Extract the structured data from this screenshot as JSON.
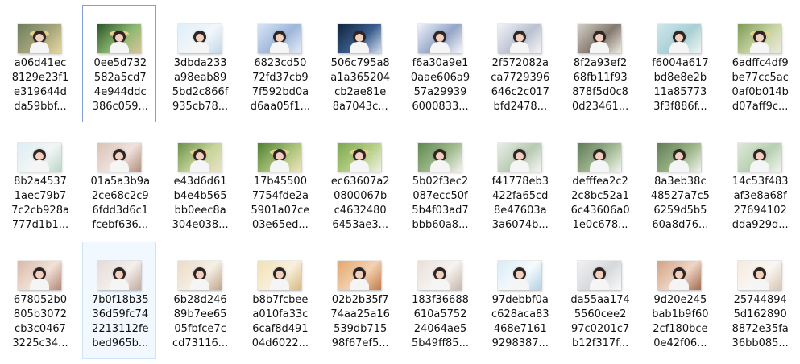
{
  "files": [
    {
      "name": "a06d41ec\n8129e23f1\ne319644d\nda59bbf...",
      "colors": [
        "#6c7e5e",
        "#a8a77c",
        "#e9d8a3"
      ]
    },
    {
      "name": "0ee5d732\n582a5cd7\n4e944ddc\n386c059...",
      "colors": [
        "#2c5728",
        "#8fb873",
        "#d7c69a"
      ]
    },
    {
      "name": "3dbda233\na98eab89\n5bd2c866f\n935cb78...",
      "colors": [
        "#dfeef9",
        "#f2f7fb",
        "#c4d7e7"
      ]
    },
    {
      "name": "6823cd50\n72fd37cb9\n7f592bd0a\nd6aa05f1...",
      "colors": [
        "#d8e5f6",
        "#9eb6da",
        "#e8edf5"
      ]
    },
    {
      "name": "506c795a8\na1a365204\ncb2ae81e\n8a7043c...",
      "colors": [
        "#10243f",
        "#3a5e8d",
        "#d8e0f0"
      ]
    },
    {
      "name": "f6a30a9e1\n0aae606a9\n57a29939\n6000833...",
      "colors": [
        "#eef2fb",
        "#94a5c7",
        "#f6f7fb"
      ]
    },
    {
      "name": "2f572082a\nca7729396\n646c2c017\nbfd2478...",
      "colors": [
        "#f0f2f7",
        "#bac1d0",
        "#f8f8f8"
      ]
    },
    {
      "name": "8f2a93ef2\n68fb11f93\n878f5d0c8\n0d23461...",
      "colors": [
        "#d3d0c8",
        "#84796e",
        "#f0ede7"
      ]
    },
    {
      "name": "f6004a617\nbd8e8e2b\n11a85773\n3f3f886f...",
      "colors": [
        "#cfe6ec",
        "#a7d0d4",
        "#f3f6f4"
      ]
    },
    {
      "name": "6adffc4df9\nbe77cc5ac\n0af0b014b\nd07aff9c...",
      "colors": [
        "#7d9c57",
        "#c8d5a3",
        "#eeeadf"
      ]
    },
    {
      "name": "8b2a4537\n1aec79b7\n7c2cb928a\n777d1b1...",
      "colors": [
        "#dceef3",
        "#f2f6f5",
        "#bbd6c8"
      ]
    },
    {
      "name": "01a5a3b9a\n2ce68c2c9\n6fdd3d6c1\nfcebf636...",
      "colors": [
        "#d9c2b6",
        "#efe2dd",
        "#b38f7c"
      ]
    },
    {
      "name": "e43d6d61\nb4e4b565\nbb0eec8a\n304e038...",
      "colors": [
        "#689048",
        "#c6d49a",
        "#e9e2c6"
      ]
    },
    {
      "name": "17b45500\n7754fde2a\n5901a07ce\n03e65ed...",
      "colors": [
        "#4f7f35",
        "#a7c276",
        "#f0e5bf"
      ]
    },
    {
      "name": "ec63607a2\n0800067b\nc4632480\n6453ae3...",
      "colors": [
        "#7aa650",
        "#b5cf84",
        "#f0f0e8"
      ]
    },
    {
      "name": "5b02f3ec2\n087ecc50f\n5b4f03ad7\nbbb60a8...",
      "colors": [
        "#5f8850",
        "#9fb98d",
        "#f2f2ee"
      ]
    },
    {
      "name": "f41778eb3\n422fa65cd\n8e47603a\n3a6074b...",
      "colors": [
        "#e9efe7",
        "#b7c9b3",
        "#f6f7f4"
      ]
    },
    {
      "name": "defffea2c2\n2c8bc52a1\n6c43606a0\n1e0c678...",
      "colors": [
        "#5f7b59",
        "#a0b78f",
        "#f3f6ef"
      ]
    },
    {
      "name": "8a3eb38c\n48527a7c5\n6259d5b5\n60a8d76...",
      "colors": [
        "#617d55",
        "#9bb488",
        "#f0f2ec"
      ]
    },
    {
      "name": "14c53f483\naf3e8a68f\n27694102\ndda929d...",
      "colors": [
        "#dfe9da",
        "#b7cfb1",
        "#f3f5f0"
      ]
    },
    {
      "name": "678052b0\n805b3072\ncb3c0467\n3225c34...",
      "colors": [
        "#d7b9a8",
        "#f2e1d7",
        "#b38878"
      ]
    },
    {
      "name": "7b0f18b35\n36d59fc74\n2213112fe\nbed965b...",
      "colors": [
        "#e3dbd6",
        "#f4efec",
        "#c2aaa0"
      ]
    },
    {
      "name": "6b28d246\n89b7ee65\n05fbfce7c\ncd73116...",
      "colors": [
        "#eadbc7",
        "#f6efe4",
        "#c0a78d"
      ]
    },
    {
      "name": "b8b7fcbee\na010fa33c\n6caf8d491\n04d6022...",
      "colors": [
        "#f2e0b6",
        "#f8f0dc",
        "#d8b882"
      ]
    },
    {
      "name": "02b2b35f7\n74aa25a16\n539db715\n98f67ef5...",
      "colors": [
        "#e2a66e",
        "#f3d2b2",
        "#c27d4a"
      ]
    },
    {
      "name": "183f36688\n610a5752\n24064ae5\n5b49ff85...",
      "colors": [
        "#e9dfd9",
        "#f7f3f0",
        "#c7b7ad"
      ]
    },
    {
      "name": "97debbf0a\nc628aca83\n468e7161\n9298387...",
      "colors": [
        "#d9ebf6",
        "#f5fafd",
        "#b4d1e5"
      ]
    },
    {
      "name": "da55aa174\n5560cee2\n97c0201c7\nb12f317f...",
      "colors": [
        "#f1f1f1",
        "#d5d8dc",
        "#fafafa"
      ]
    },
    {
      "name": "9d20e245\nbab1b9f60\n2cf180bce\n0e42f06...",
      "colors": [
        "#d2a384",
        "#efd5c5",
        "#a16d50"
      ]
    },
    {
      "name": "25744894\n5d162890\n8872e35fa\n36bb085...",
      "colors": [
        "#f5eadf",
        "#faf6f2",
        "#d8c4b1"
      ]
    }
  ]
}
